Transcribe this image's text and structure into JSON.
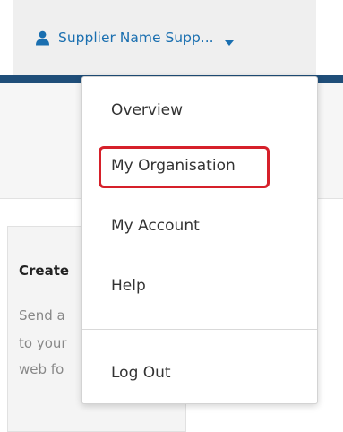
{
  "header": {
    "user_menu_label": "Supplier Name Supp...",
    "accent_color": "#1f4e79",
    "link_color": "#1a6fb0"
  },
  "card": {
    "title": "Create",
    "lines": [
      "Send a",
      "to your",
      "web fo"
    ]
  },
  "dropdown": {
    "items": [
      {
        "label": "Overview"
      },
      {
        "label": "My Organisation",
        "highlighted": true
      },
      {
        "label": "My Account"
      },
      {
        "label": "Help"
      },
      {
        "label": "Log Out"
      }
    ],
    "highlight_color": "#d6202a"
  },
  "icons": {
    "user": "user-icon",
    "caret": "chevron-down-icon"
  }
}
